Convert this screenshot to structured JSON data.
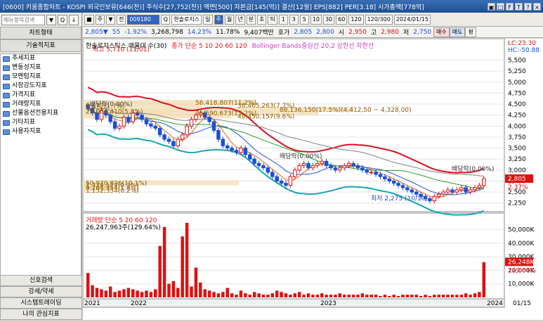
{
  "window": {
    "title": "[0600] 키움종합차트 - KOSPI 외국인보유[646(천)] 주식수[27,752(천)] 액면[500] 자본금[145(억)] 결산[12월] EPS[882] PER[3.18] 시가총액[778억]",
    "buttons": [
      "▣",
      "□",
      "F",
      "T",
      "?",
      "×"
    ]
  },
  "sidebar": {
    "search_placeholder": "메뉴항목검색",
    "search_buttons": [
      "▼",
      "Q",
      "↓"
    ],
    "chart_type_header": "차트형태",
    "tech_header": "기술적지표",
    "items": [
      "추세지표",
      "변동성지표",
      "모멘텀지표",
      "시장강도지표",
      "가격지표",
      "거래량지표",
      "선물옵션전용지표",
      "기타지표",
      "사용자지표"
    ],
    "bottom_items": [
      "신호검색",
      "강세/약세",
      "시스템트레이딩",
      "나의 관심지표"
    ]
  },
  "toolbar1": {
    "left_buttons": [
      "■",
      "주",
      "▼",
      "전"
    ],
    "code": "009180",
    "name": "한솔로지스",
    "periods": [
      "일",
      "주",
      "월",
      "년",
      "분",
      "초",
      "틱"
    ],
    "active_period": "주",
    "minutes": [
      "1",
      "3",
      "5",
      "10",
      "30",
      "60",
      "120"
    ],
    "count": "120/300",
    "date": "2024/01/15"
  },
  "toolbar2": {
    "price": "2,805▼",
    "change": "55",
    "change_pct": "-1.92%",
    "volume": "3,268,798",
    "vol_pct": "14.23%",
    "rate": "11.78%",
    "amount": "9,407백만",
    "ho_label": "호가",
    "ask": "2,805",
    "bid": "2,800",
    "open_label": "시",
    "open": "2,950",
    "high_label": "고",
    "high": "2,980",
    "low_label": "저",
    "low": "2,750",
    "buy": "매수",
    "sell": "매도",
    "extra": "평"
  },
  "chart_data": {
    "type": "candlestick",
    "price_legend": "한솔로지스틱스 매물대 수(30)",
    "ma_legend": "종가 단순 5 10 20 60 120",
    "bb_legend": "Bollinger Bands중심선 20,2 상한선 하한선",
    "lc": "LC:23.30",
    "hc": "HC:-50.88",
    "price_ticks": [
      "5,500",
      "5,250",
      "5,000",
      "4,750",
      "4,500",
      "4,250",
      "4,000",
      "3,750",
      "3,500",
      "3,250",
      "3,000",
      "2,750",
      "2,500",
      "2,250"
    ],
    "price_ylim": [
      2150,
      5700
    ],
    "current_price": "2,805",
    "current_pct": "2.37%",
    "annotations": [
      "최고 5,710 (11/01)",
      "최저 2,275 (10/10)",
      "배당락(0.00%)",
      "배당락(0.00%)",
      "배당락(0.00%)"
    ],
    "volume_profile": [
      {
        "label": "56,418,807(11.2%)",
        "price": 4530
      },
      {
        "label": "38,465,263(7.7%)",
        "price": 4470
      },
      {
        "label": "88,136,150(17.5%)(4,412,50 ~ 4,328,00)",
        "price": 4370
      },
      {
        "label": "76,590,673(15.2%)",
        "price": 4290
      },
      {
        "label": "48,450,157(9.6%)",
        "price": 4220
      },
      {
        "label": "29,084,410(5.8%)",
        "price": 4330
      },
      {
        "label": "5,872(1.7%)",
        "price": 4450
      },
      {
        "label": "50,970,826(10.1%)",
        "price": 2700
      },
      {
        "label": "1,719,512(0.3%)",
        "price": 2650
      },
      {
        "label": "9,205,354(1.8%)",
        "price": 2590
      },
      {
        "label": "1,152,354(0.2%)",
        "price": 2530
      }
    ],
    "volume_legend": "거래량 단순 5 20 60 120",
    "volume_max_label": "26,247,963주(129.64%)",
    "volume_ticks": [
      "50,000K",
      "40,000K",
      "30,000K",
      "20,000K",
      "10,000K"
    ],
    "volume_current": "26,248K",
    "volume_current_pct": "129.64%",
    "x_labels": [
      "2021",
      "2022",
      "2023",
      "2024"
    ],
    "x_right": "01/15",
    "closes": [
      4400,
      4300,
      4150,
      4350,
      4250,
      4100,
      3950,
      4000,
      4200,
      4100,
      4300,
      4250,
      4150,
      4050,
      4000,
      3950,
      3800,
      3700,
      3650,
      3550,
      3700,
      3800,
      4000,
      4150,
      4250,
      4300,
      4200,
      4100,
      3900,
      3700,
      3550,
      3500,
      3450,
      3400,
      3500,
      3350,
      3250,
      3150,
      3100,
      3050,
      2950,
      2850,
      2750,
      2700,
      2650,
      2850,
      3000,
      3100,
      3150,
      3050,
      3100,
      3150,
      3200,
      3100,
      3050,
      3000,
      3050,
      3100,
      3150,
      3100,
      3050,
      3000,
      2950,
      2950,
      2900,
      2850,
      2800,
      2750,
      2700,
      2650,
      2600,
      2550,
      2500,
      2450,
      2400,
      2350,
      2300,
      2400,
      2450,
      2500,
      2550,
      2500,
      2550,
      2600,
      2500,
      2550,
      2600,
      2650,
      2805
    ],
    "volumes": [
      18,
      9,
      7,
      6,
      5,
      8,
      4,
      5,
      6,
      7,
      6,
      5,
      4,
      5,
      4,
      6,
      38,
      52,
      10,
      12,
      7,
      45,
      55,
      8,
      22,
      11,
      6,
      5,
      4,
      3,
      4,
      7,
      3,
      2,
      5,
      3,
      2,
      4,
      3,
      2,
      2,
      3,
      5,
      4,
      3,
      2,
      3,
      4,
      2,
      3,
      2,
      2,
      3,
      2,
      2,
      2,
      3,
      2,
      2,
      2,
      2,
      3,
      2,
      2,
      2,
      1,
      2,
      1,
      2,
      1,
      2,
      2,
      2,
      2,
      1,
      2,
      1,
      2,
      2,
      2,
      2,
      2,
      2,
      2,
      3,
      2,
      3,
      4,
      26
    ]
  }
}
